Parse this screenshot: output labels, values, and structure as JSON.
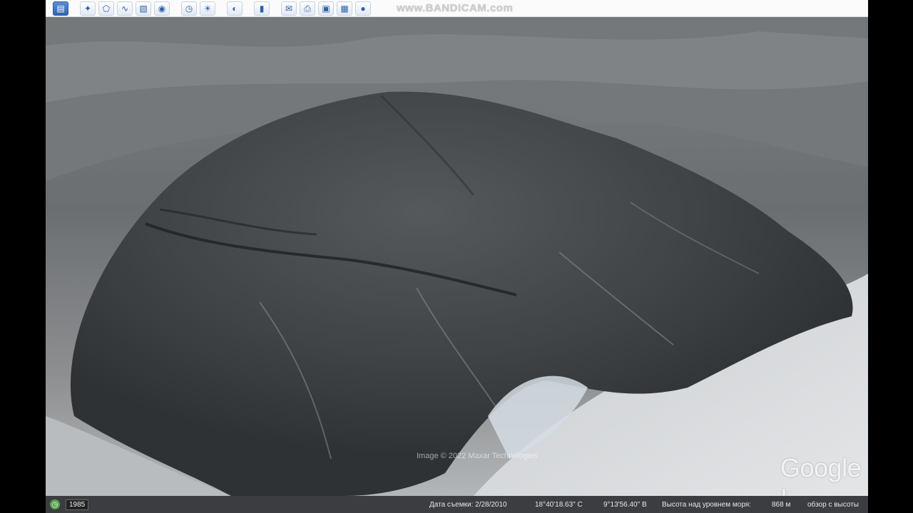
{
  "toolbar": {
    "watermark": "www.BANDICAM.com",
    "buttons": [
      {
        "name": "sidebar-toggle-button",
        "icon": "▤"
      },
      {
        "name": "add-placemark-button",
        "icon": "✦"
      },
      {
        "name": "add-polygon-button",
        "icon": "⬠"
      },
      {
        "name": "add-path-button",
        "icon": "∿"
      },
      {
        "name": "add-image-overlay-button",
        "icon": "▧"
      },
      {
        "name": "record-tour-button",
        "icon": "◉"
      },
      {
        "name": "historical-imagery-button",
        "icon": "◷"
      },
      {
        "name": "sunlight-button",
        "icon": "☀"
      },
      {
        "name": "planets-button",
        "icon": "◐"
      },
      {
        "name": "ruler-button",
        "icon": "▮"
      },
      {
        "name": "email-button",
        "icon": "✉"
      },
      {
        "name": "print-button",
        "icon": "⎙"
      },
      {
        "name": "save-image-button",
        "icon": "▣"
      },
      {
        "name": "map-view-button",
        "icon": "▦"
      },
      {
        "name": "earth-view-button",
        "icon": "●"
      }
    ]
  },
  "viewport": {
    "attribution": "Image © 2022 Maxar Technologies",
    "logo": "Google I"
  },
  "statusbar": {
    "year": "1985",
    "imagery_date": "Дата съемки: 2/28/2010",
    "latitude": "18°40'18.63\" С",
    "longitude": "9°13'56.40\" В",
    "elevation_label": "Высота над уровнем моря:",
    "elevation_value": "868 м",
    "eye_alt": "обзор с высоты"
  }
}
